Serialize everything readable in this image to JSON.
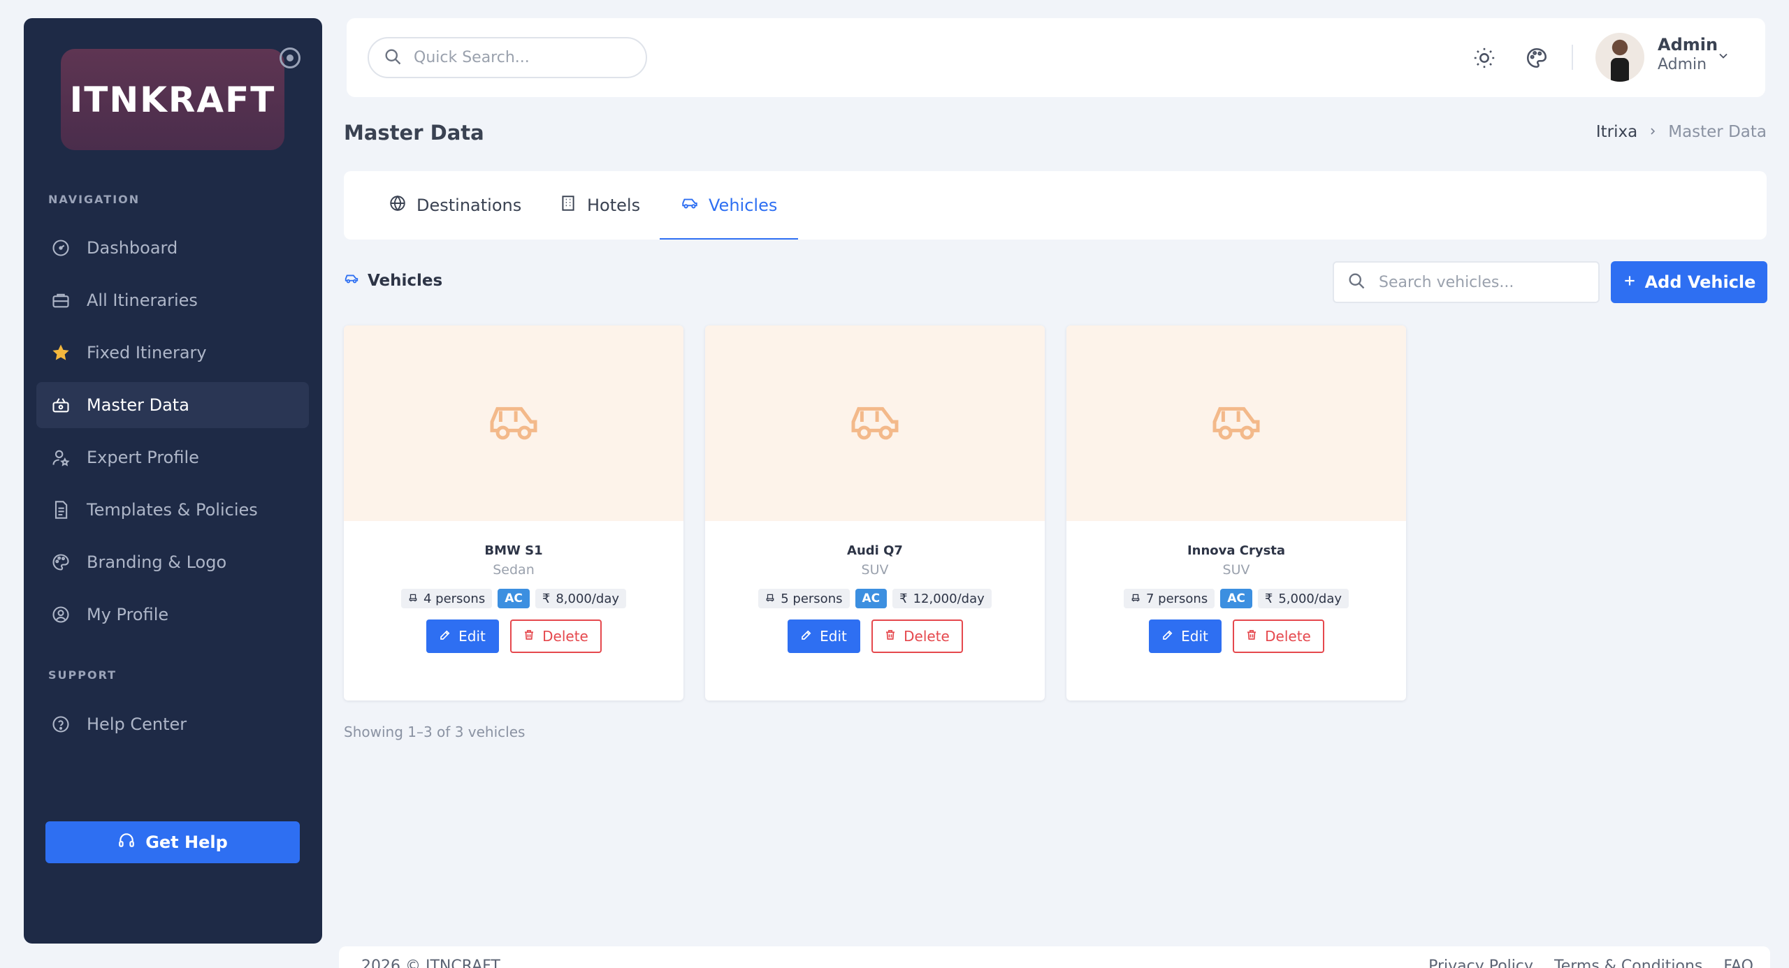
{
  "sidebar": {
    "logo": "ITNKRAFT",
    "nav_label": "NAVIGATION",
    "support_label": "SUPPORT",
    "items": [
      {
        "label": "Dashboard",
        "icon": "gauge-icon"
      },
      {
        "label": "All Itineraries",
        "icon": "briefcase-icon"
      },
      {
        "label": "Fixed Itinerary",
        "icon": "star-icon"
      },
      {
        "label": "Master Data",
        "icon": "basket-icon"
      },
      {
        "label": "Expert Profile",
        "icon": "user-star-icon"
      },
      {
        "label": "Templates & Policies",
        "icon": "document-icon"
      },
      {
        "label": "Branding & Logo",
        "icon": "palette-icon"
      },
      {
        "label": "My Profile",
        "icon": "user-circle-icon"
      }
    ],
    "support_items": [
      {
        "label": "Help Center",
        "icon": "help-circle-icon"
      }
    ],
    "get_help": "Get Help",
    "active_index": 3
  },
  "topbar": {
    "search_placeholder": "Quick Search...",
    "user_name": "Admin",
    "user_role": "Admin"
  },
  "page": {
    "title": "Master Data",
    "breadcrumb_root": "Itrixa",
    "breadcrumb_current": "Master Data"
  },
  "tabs": [
    {
      "label": "Destinations",
      "icon": "globe-icon"
    },
    {
      "label": "Hotels",
      "icon": "building-icon"
    },
    {
      "label": "Vehicles",
      "icon": "car-icon",
      "active": true
    }
  ],
  "section": {
    "heading": "Vehicles",
    "search_placeholder": "Search vehicles...",
    "add_button": "Add Vehicle"
  },
  "vehicles": [
    {
      "name": "BMW S1",
      "type": "Sedan",
      "capacity": "4 persons",
      "ac": "AC",
      "price": "8,000/day"
    },
    {
      "name": "Audi Q7",
      "type": "SUV",
      "capacity": "5 persons",
      "ac": "AC",
      "price": "12,000/day"
    },
    {
      "name": "Innova Crysta",
      "type": "SUV",
      "capacity": "7 persons",
      "ac": "AC",
      "price": "5,000/day"
    }
  ],
  "card_actions": {
    "edit": "Edit",
    "delete": "Delete"
  },
  "currency_symbol": "₹",
  "showing_text": "Showing 1–3 of 3 vehicles",
  "footer": {
    "copyright": "2026 © ITNCRAFT",
    "links": [
      "Privacy Policy",
      "Terms & Conditions",
      "FAQ"
    ]
  },
  "colors": {
    "sidebar_bg": "#1e2a46",
    "accent": "#2e6ff2",
    "danger": "#e5484d",
    "card_media_bg": "#fdf3ea",
    "car_icon": "#f3b98a"
  }
}
